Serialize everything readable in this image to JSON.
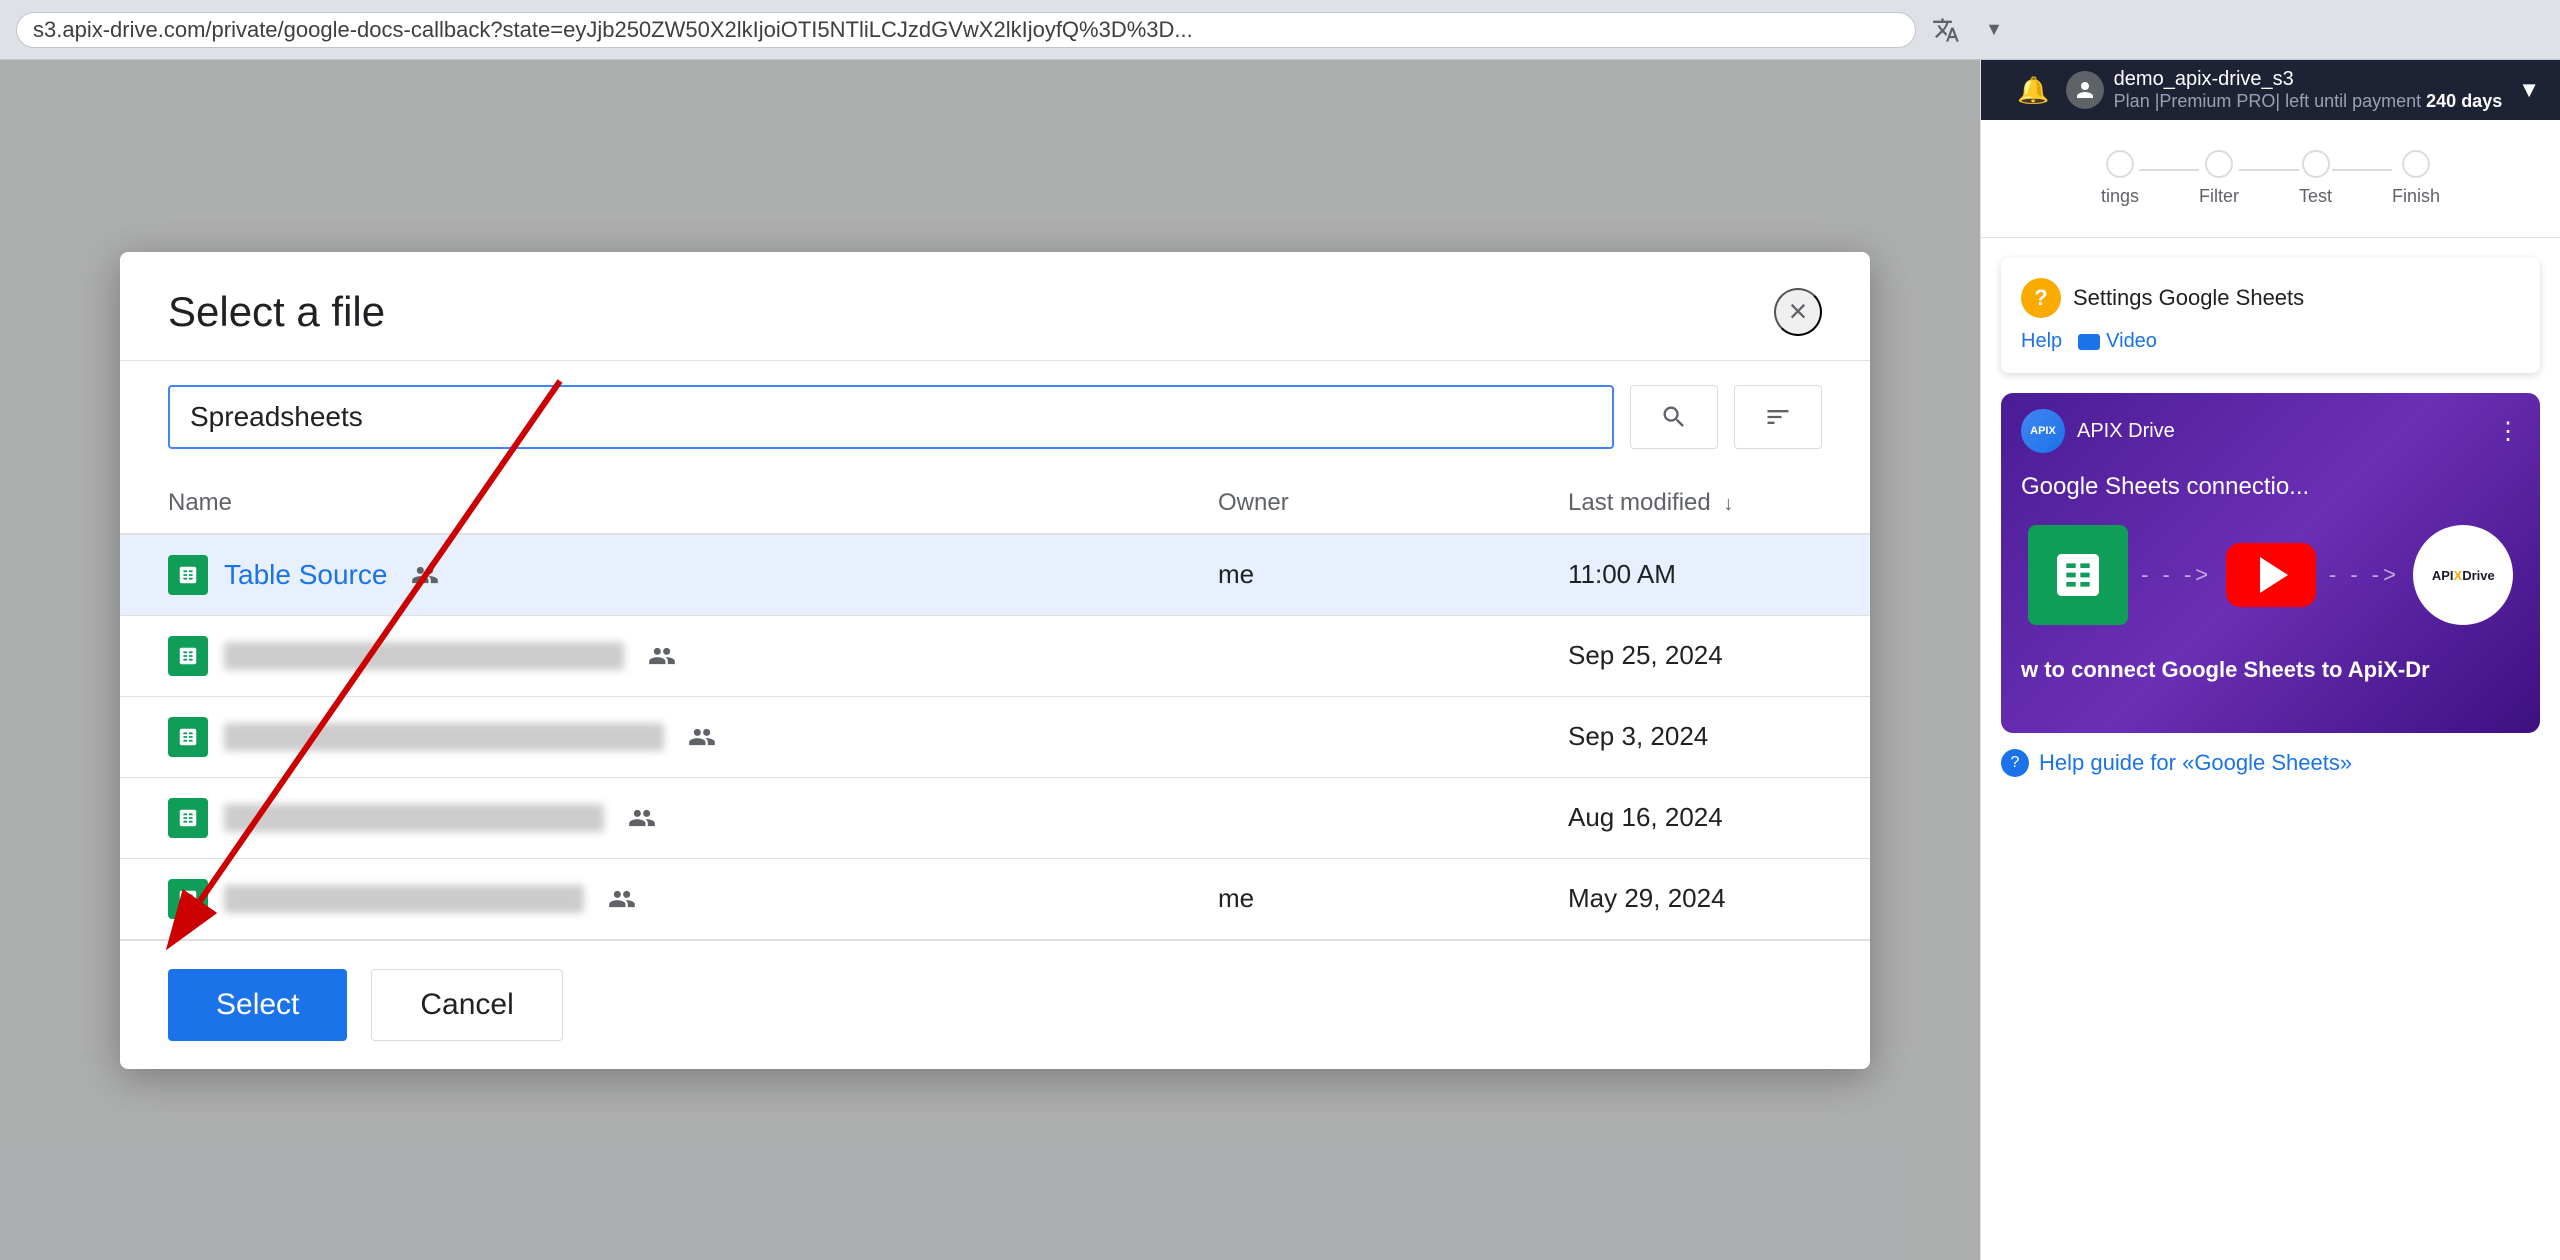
{
  "browser": {
    "url": "s3.apix-drive.com/private/google-docs-callback?state=eyJjb250ZW50X2lkIjoiOTI5NTliLCJzdGVwX2lkIjoyfQ%3D%3D...",
    "translate_icon": "🌐"
  },
  "dialog": {
    "title": "Select a file",
    "close_label": "×",
    "search_placeholder": "Spreadsheets",
    "search_value": "Spreadsheets",
    "table": {
      "headers": {
        "name": "Name",
        "owner": "Owner",
        "last_modified": "Last modified"
      },
      "rows": [
        {
          "name": "Table Source",
          "shared": true,
          "owner": "me",
          "modified": "11:00 AM",
          "selected": true
        },
        {
          "name": "████████████████████████ ██",
          "shared": true,
          "owner": "",
          "modified": "Sep 25, 2024",
          "selected": false,
          "blurred": true
        },
        {
          "name": "████████████████████████ ██",
          "shared": true,
          "owner": "",
          "modified": "Sep 3, 2024",
          "selected": false,
          "blurred": true
        },
        {
          "name": "████████████████████████ ██",
          "shared": true,
          "owner": "",
          "modified": "Aug 16, 2024",
          "selected": false,
          "blurred": true
        },
        {
          "name": "████████████████████████ ██",
          "shared": true,
          "owner": "me",
          "modified": "May 29, 2024",
          "selected": false,
          "blurred": true
        }
      ]
    },
    "footer": {
      "select_label": "Select",
      "cancel_label": "Cancel"
    }
  },
  "right_panel": {
    "user": {
      "name": "demo_apix-drive_s3",
      "plan": "Plan |Premium PRO| left until payment",
      "days": "240 days"
    },
    "steps": [
      {
        "label": "tings",
        "active": false
      },
      {
        "label": "Filter",
        "active": false
      },
      {
        "label": "Test",
        "active": false
      },
      {
        "label": "Finish",
        "active": false
      }
    ],
    "help_box": {
      "title": "Settings Google Sheets",
      "help_link": "Help",
      "video_link": "Video"
    },
    "video": {
      "channel_name": "APIX Drive",
      "title": "Google Sheets connectio...",
      "caption": "w to connect Google Sheets to ApiX-Dr",
      "menu_icon": "⋮"
    },
    "help_guide": {
      "text": "Help guide for «Google Sheets»"
    }
  }
}
